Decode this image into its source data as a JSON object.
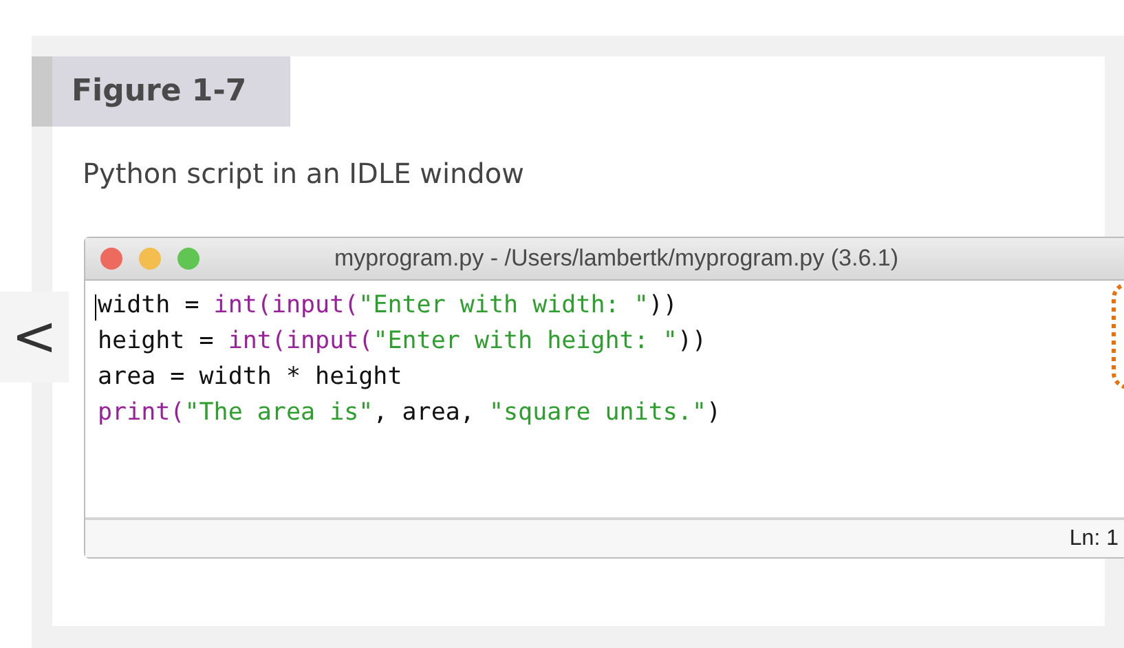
{
  "figure": {
    "label": "Figure 1-7",
    "caption": "Python script in an IDLE window"
  },
  "back_button": {
    "glyph": "<"
  },
  "window": {
    "title": "myprogram.py - /Users/lambertk/myprogram.py (3.6.1)",
    "code_lines": [
      [
        {
          "kind": "plain",
          "text": "width = "
        },
        {
          "kind": "builtin",
          "text": "int(input("
        },
        {
          "kind": "string",
          "text": "\"Enter with width: \""
        },
        {
          "kind": "plain",
          "text": "))"
        }
      ],
      [
        {
          "kind": "plain",
          "text": "height = "
        },
        {
          "kind": "builtin",
          "text": "int(input("
        },
        {
          "kind": "string",
          "text": "\"Enter with height: \""
        },
        {
          "kind": "plain",
          "text": "))"
        }
      ],
      [
        {
          "kind": "plain",
          "text": "area = width * height"
        }
      ],
      [
        {
          "kind": "builtin",
          "text": "print("
        },
        {
          "kind": "string",
          "text": "\"The area is\""
        },
        {
          "kind": "plain",
          "text": ", area, "
        },
        {
          "kind": "string",
          "text": "\"square units.\""
        },
        {
          "kind": "plain",
          "text": ")"
        }
      ]
    ],
    "status_bar": "Ln: 1"
  }
}
